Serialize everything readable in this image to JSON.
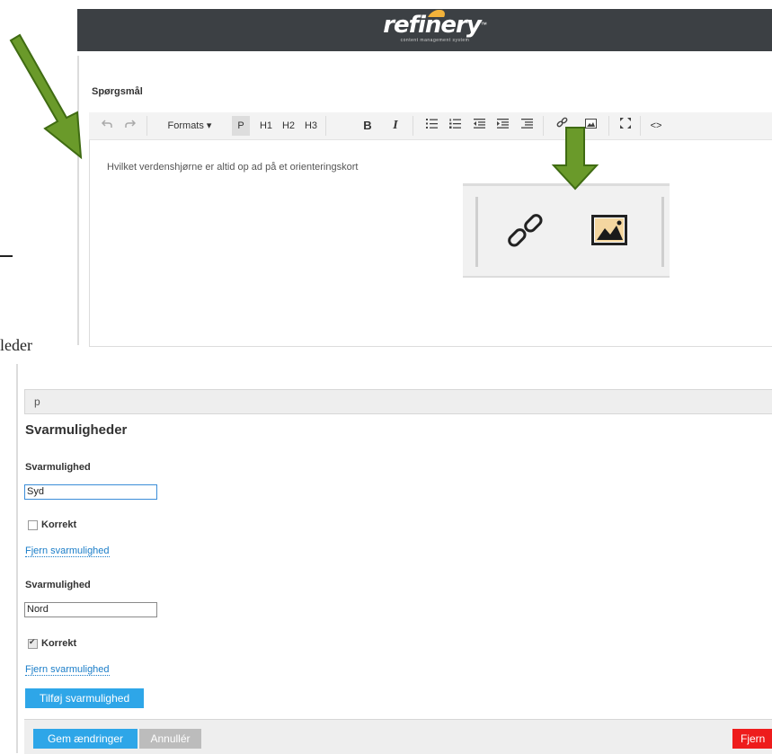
{
  "top": {
    "logo": {
      "word": "refinery",
      "tm": "™",
      "sub": "content management system"
    },
    "field_label": "Spørgsmål",
    "toolbar": {
      "undo_icon": "undo-icon",
      "redo_icon": "redo-icon",
      "formats": "Formats ▾",
      "p": "P",
      "h1": "H1",
      "h2": "H2",
      "h3": "H3",
      "bold": "B",
      "italic": "I",
      "code": "<>"
    },
    "editor_text": "Hvilket verdenshjørne er altid op ad på et orienteringskort",
    "arrow_color": "#6a9a2a",
    "cropped_text": "leder"
  },
  "bottom": {
    "path_value": "p",
    "section_title": "Svarmuligheder",
    "options": [
      {
        "label": "Svarmulighed",
        "value": "Syd",
        "correct_label": "Korrekt",
        "correct": false,
        "remove": "Fjern svarmulighed"
      },
      {
        "label": "Svarmulighed",
        "value": "Nord",
        "correct_label": "Korrekt",
        "correct": true,
        "remove": "Fjern svarmulighed"
      }
    ],
    "add_button": "Tilføj svarmulighed",
    "save_button": "Gem ændringer",
    "cancel_button": "Annullér",
    "remove_button": "Fjern",
    "colors": {
      "primary": "#2ea6e8",
      "danger": "#ee1c1c",
      "header": "#3c4044"
    }
  }
}
